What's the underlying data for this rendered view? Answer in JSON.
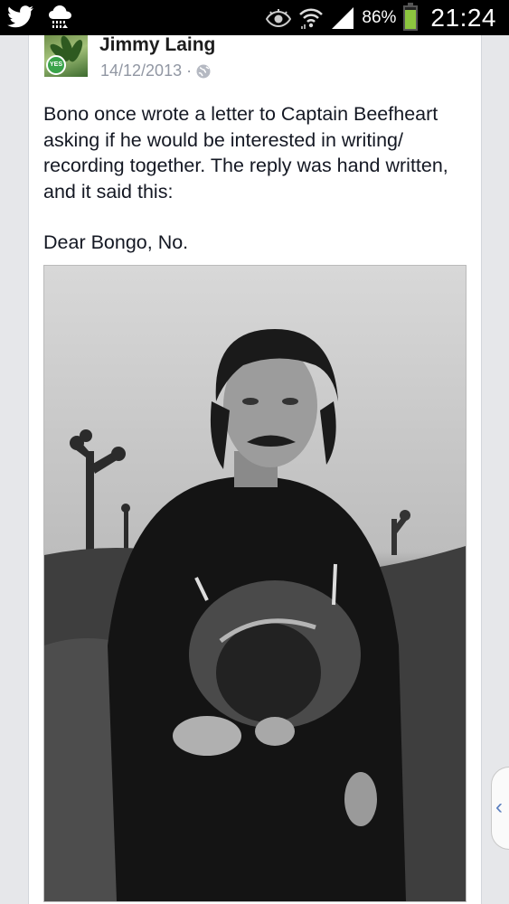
{
  "status_bar": {
    "battery_percent": "86%",
    "battery_level": 0.86,
    "time": "21:24",
    "icons": [
      "twitter-bird-icon",
      "weather-cloud-icon",
      "eye-icon",
      "wifi-icon",
      "signal-icon",
      "battery-icon"
    ]
  },
  "post": {
    "author": "Jimmy Laing",
    "date": "14/12/2013",
    "separator": "·",
    "privacy_icon": "globe-icon",
    "avatar_badge": "YES",
    "text_paragraph_1": "Bono once wrote a letter to Captain Beefheart asking if he would be interested in writing/ recording together. The reply was hand written, and it said this:",
    "text_paragraph_2": "Dear Bongo, No.",
    "photo": "black-and-white portrait of a man in a dark sweater holding a hat in a desert with joshua trees"
  },
  "side_handle": {
    "icon": "chevron-left-icon",
    "glyph": "‹"
  },
  "colors": {
    "status_bar_bg": "#000000",
    "battery_fill": "#8cc63f",
    "meta_text": "#9197a3",
    "handle_chevron": "#5b7fbf"
  }
}
